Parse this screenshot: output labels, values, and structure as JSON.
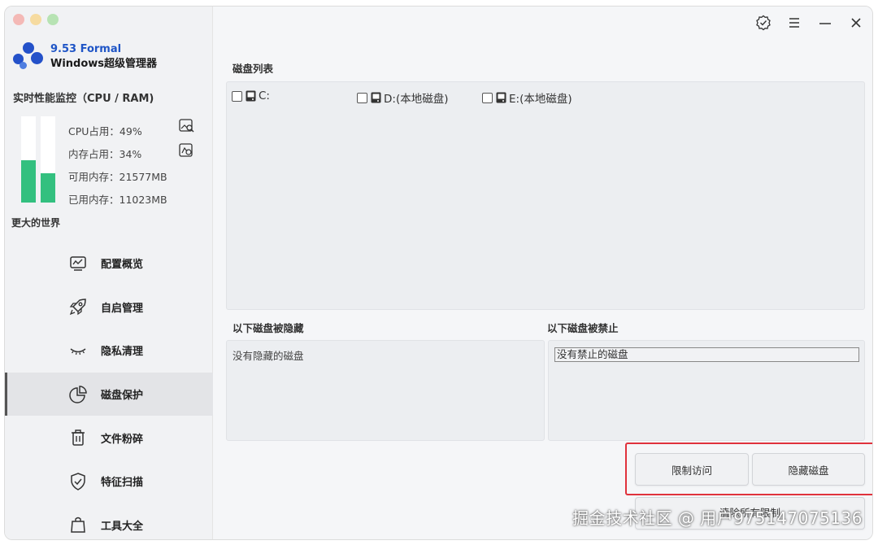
{
  "window": {
    "traffic_colors": [
      "#f4b9b6",
      "#f6dba0",
      "#b7e3b3"
    ]
  },
  "brand": {
    "version": "9.53 Formal",
    "name": "Windows超级管理器",
    "logo_icon": "three-dot-logo-icon",
    "color": "#1f55c6"
  },
  "perf": {
    "title": "实时性能监控（CPU / RAM)",
    "cpu_percent": 49,
    "ram_percent": 34,
    "stats": {
      "cpu": "CPU占用：49%",
      "ram": "内存占用：34%",
      "available": "可用内存：21577MB",
      "used": "已用内存：11023MB"
    },
    "bar_color": "#33c07f"
  },
  "world_label": "更大的世界",
  "nav": [
    {
      "label": "配置概览",
      "icon": "monitor-chart-icon"
    },
    {
      "label": "自启管理",
      "icon": "rocket-icon"
    },
    {
      "label": "隐私清理",
      "icon": "closed-eye-icon"
    },
    {
      "label": "磁盘保护",
      "icon": "pie-chart-icon",
      "active": true
    },
    {
      "label": "文件粉碎",
      "icon": "trash-icon"
    },
    {
      "label": "特征扫描",
      "icon": "shield-check-icon"
    },
    {
      "label": "工具大全",
      "icon": "bag-icon"
    }
  ],
  "topbar": {
    "icons": [
      "badge-check-icon",
      "menu-icon",
      "minimize-icon",
      "close-icon"
    ]
  },
  "disk_list": {
    "label": "磁盘列表",
    "items": [
      {
        "label": "C:",
        "checked": false
      },
      {
        "label": "D:(本地磁盘)",
        "checked": false
      },
      {
        "label": "E:(本地磁盘)",
        "checked": false
      }
    ]
  },
  "hidden_panel": {
    "label": "以下磁盘被隐藏",
    "content": "没有隐藏的磁盘"
  },
  "forbidden_panel": {
    "label": "以下磁盘被禁止",
    "content": "没有禁止的磁盘"
  },
  "buttons": {
    "restrict": "限制访问",
    "hide": "隐藏磁盘",
    "clear": "清除所有限制"
  },
  "highlight_color": "#e0323c",
  "watermark": "掘金技术社区 @ 用户975147075136"
}
